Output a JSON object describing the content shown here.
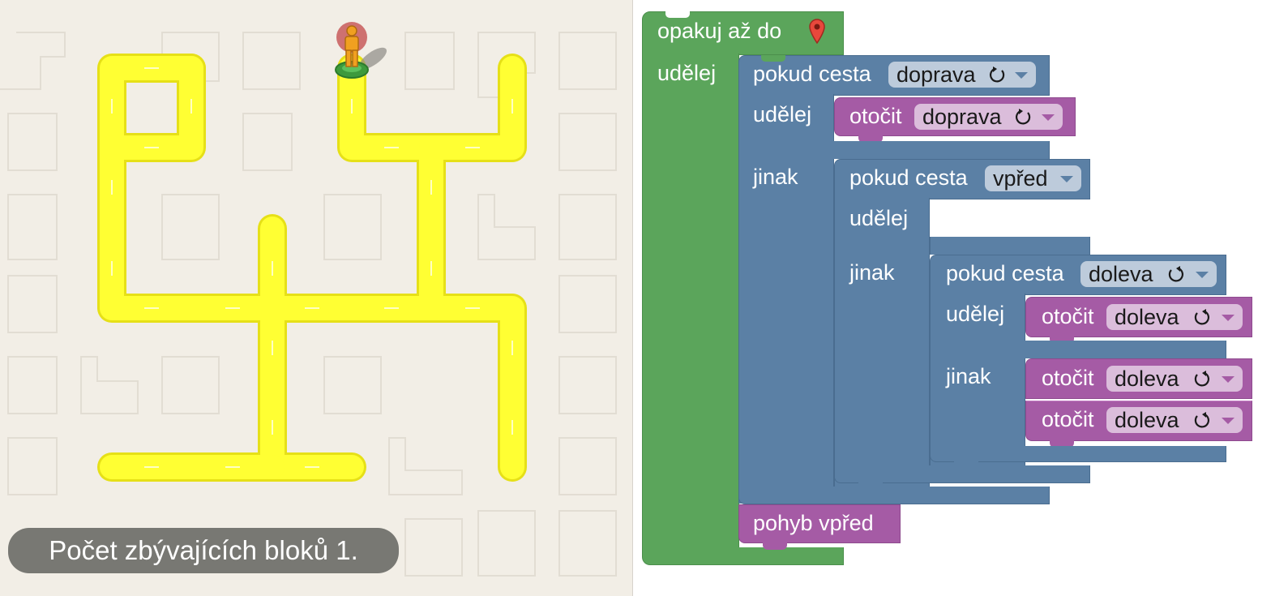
{
  "counter": {
    "text": "Počet zbývajících bloků 1."
  },
  "colors": {
    "loop": "#5ba55b",
    "logic": "#5b80a5",
    "action": "#a55ba5",
    "path": "#ffff33",
    "ground": "#f2eee6"
  },
  "icons": {
    "marker": "map-pin-icon",
    "turn_right": "rotate-clockwise-icon",
    "turn_left": "rotate-counterclockwise-icon",
    "avatar": "pegman-icon"
  },
  "program": {
    "repeat": {
      "label": "opakuj až do",
      "do_label": "udělej"
    },
    "if1": {
      "label": "pokud cesta",
      "direction": "doprava",
      "do_label": "udělej",
      "else_label": "jinak"
    },
    "turn1": {
      "label": "otočit",
      "direction": "doprava"
    },
    "if2": {
      "label": "pokud cesta",
      "direction": "vpřed",
      "do_label": "udělej",
      "else_label": "jinak"
    },
    "if3": {
      "label": "pokud cesta",
      "direction": "doleva",
      "do_label": "udělej",
      "else_label": "jinak"
    },
    "turn2": {
      "label": "otočit",
      "direction": "doleva"
    },
    "turn3": {
      "label": "otočit",
      "direction": "doleva"
    },
    "turn4": {
      "label": "otočit",
      "direction": "doleva"
    },
    "move": {
      "label": "pohyb vpřed"
    }
  }
}
